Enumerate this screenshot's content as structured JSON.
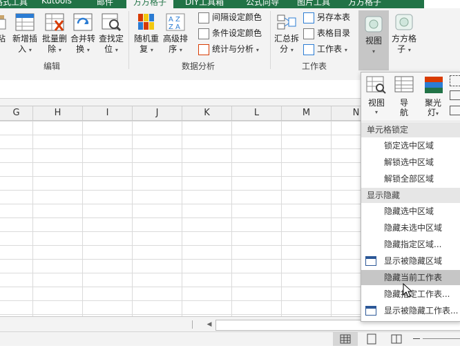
{
  "tabs": {
    "items": [
      "格式工具",
      "Kutools",
      "邮件",
      "方方格子",
      "DIY工具箱",
      "公式向导",
      "图片工具",
      "方方格子"
    ],
    "active_index": 3
  },
  "ribbon": {
    "edit_group": {
      "label": "编辑",
      "paste": "粘",
      "add_insert": "新增插\n入",
      "batch_delete": "批量删\n除",
      "merge_convert": "合并转\n换",
      "find_locate": "查找定\n位"
    },
    "analysis_group": {
      "label": "数据分析",
      "random_repeat": "随机重\n复",
      "advanced_sort": "高级排\n序",
      "interval_color": "间隔设定颜色",
      "condition_color": "条件设定颜色",
      "stats_analysis": "统计与分析"
    },
    "sheet_group": {
      "label": "工作表",
      "summary_split": "汇总拆\n分",
      "save_sheet": "另存本表",
      "sheet_catalog": "表格目录",
      "worksheet": "工作表"
    },
    "view_button": "视图",
    "fangfang_button": "方方格\n子"
  },
  "columns": [
    "G",
    "H",
    "I",
    "J",
    "K",
    "L",
    "M",
    "N"
  ],
  "menu": {
    "top_buttons": {
      "view": "视图",
      "navigation": "导\n航",
      "spotlight": "聚光\n灯"
    },
    "sections": [
      {
        "title": "单元格锁定",
        "items": [
          "锁定选中区域",
          "解锁选中区域",
          "解锁全部区域"
        ]
      },
      {
        "title": "显示隐藏",
        "items": [
          "隐藏选中区域",
          "隐藏未选中区域",
          "隐藏指定区域...",
          "显示被隐藏区域",
          "隐藏当前工作表",
          "隐藏指定工作表...",
          "显示被隐藏工作表..."
        ]
      }
    ],
    "hovered_item": "隐藏当前工作表"
  },
  "colors": {
    "tab_green": "#217346",
    "ribbon_bg": "#f3f3f3",
    "menu_hover": "#c6c6c6",
    "section_bg": "#e6e6e6"
  }
}
